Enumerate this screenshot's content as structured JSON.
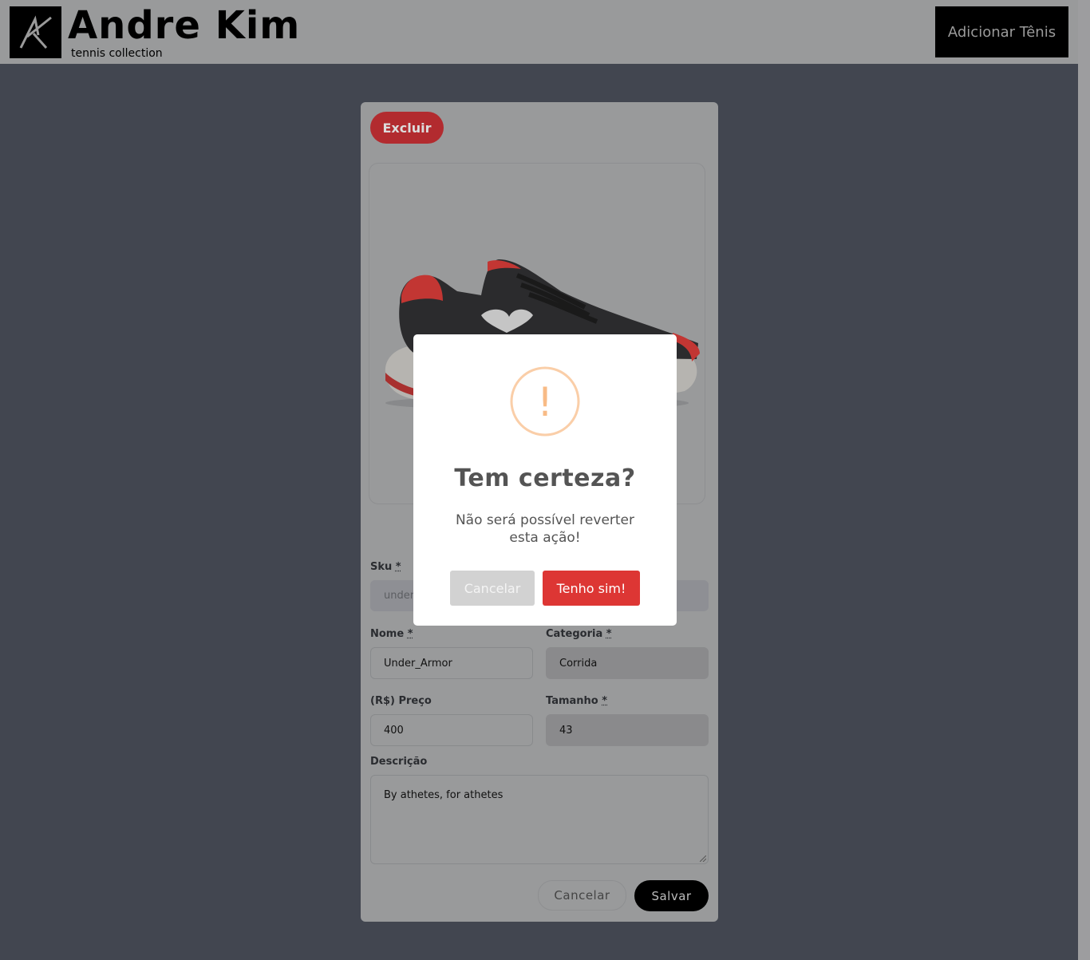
{
  "header": {
    "brand_name": "Andre Kim",
    "brand_sub": "tennis collection",
    "add_button": "Adicionar Tênis"
  },
  "form": {
    "delete_button": "Excluir",
    "required_mark": "*",
    "sku": {
      "label": "Sku",
      "value": "under_"
    },
    "nome": {
      "label": "Nome",
      "value": "Under_Armor"
    },
    "categoria": {
      "label": "Categoria",
      "value": "Corrida"
    },
    "preco": {
      "label": "(R$) Preço",
      "value": "400"
    },
    "tamanho": {
      "label": "Tamanho",
      "value": "43"
    },
    "descricao": {
      "label": "Descrição",
      "value": "By athetes, for athetes"
    },
    "cancel_button": "Cancelar",
    "save_button": "Salvar"
  },
  "modal": {
    "icon": "warning-icon",
    "icon_glyph": "!",
    "title": "Tem certeza?",
    "text": "Não será possível reverter esta ação!",
    "cancel_button": "Cancelar",
    "confirm_button": "Tenho sim!"
  },
  "colors": {
    "page_overlay": "#424650",
    "modal_confirm": "#dd3634",
    "modal_cancel": "#d2d2d2",
    "warning": "#f8bb86",
    "delete": "#b22b2f"
  }
}
